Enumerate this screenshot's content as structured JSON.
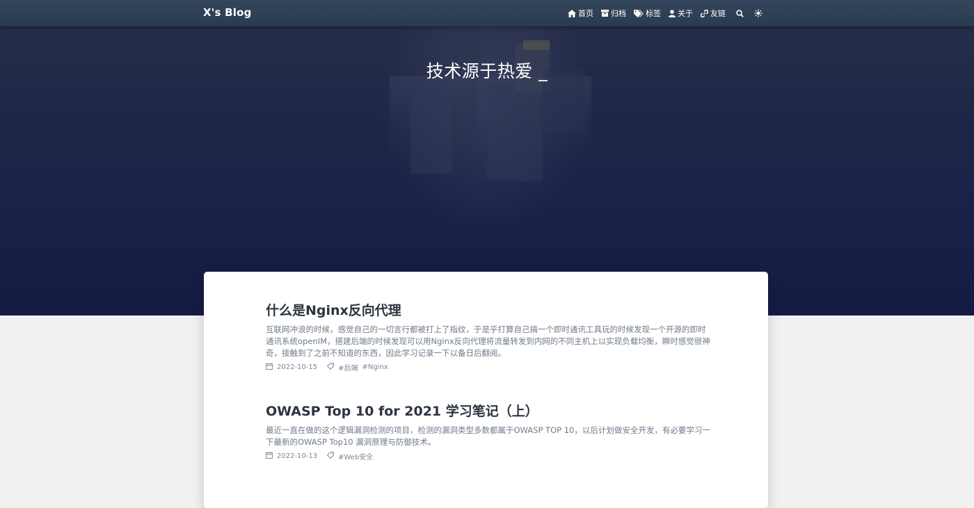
{
  "site": {
    "brand": "X's Blog"
  },
  "nav": {
    "items": [
      {
        "label": "首页",
        "icon": "home-icon"
      },
      {
        "label": "归档",
        "icon": "archive-icon"
      },
      {
        "label": "标签",
        "icon": "tags-icon"
      },
      {
        "label": "关于",
        "icon": "user-icon"
      },
      {
        "label": "友链",
        "icon": "link-icon"
      }
    ],
    "search_icon": "search-icon",
    "theme_icon": "sun-icon"
  },
  "hero": {
    "title": "技术源于热爱 _"
  },
  "posts": [
    {
      "title": "什么是Nginx反向代理",
      "summary": "互联网冲浪的时候，感觉自己的一切言行都被打上了指纹，于是乎打算自己搞一个即时通讯工具玩的时候发现一个开源的即时通讯系统openIM，搭建后端的时候发现可以用Nginx反向代理将流量转发到内网的不同主机上以实现负载均衡，瞬时感觉很神奇，接触到了之前不知道的东西，因此学习记录一下以备日后翻阅。",
      "date": "2022-10-15",
      "tags": [
        "#后端",
        "#Nginx"
      ]
    },
    {
      "title": "OWASP Top 10 for 2021 学习笔记（上）",
      "summary": "最近一直在做的这个逻辑漏洞检测的项目，检测的漏洞类型多数都属于OWASP TOP 10，以后计划做安全开发，有必要学习一下最新的OWASP Top10 漏洞原理与防御技术。",
      "date": "2022-10-13",
      "tags": [
        "#Web安全"
      ]
    }
  ],
  "colors": {
    "navbar": "#2f3f54",
    "hero_bottom": "#161b44",
    "page_bg": "#f1f1f1",
    "title_text": "#2c3440",
    "summary_text": "#6f7b8a"
  }
}
